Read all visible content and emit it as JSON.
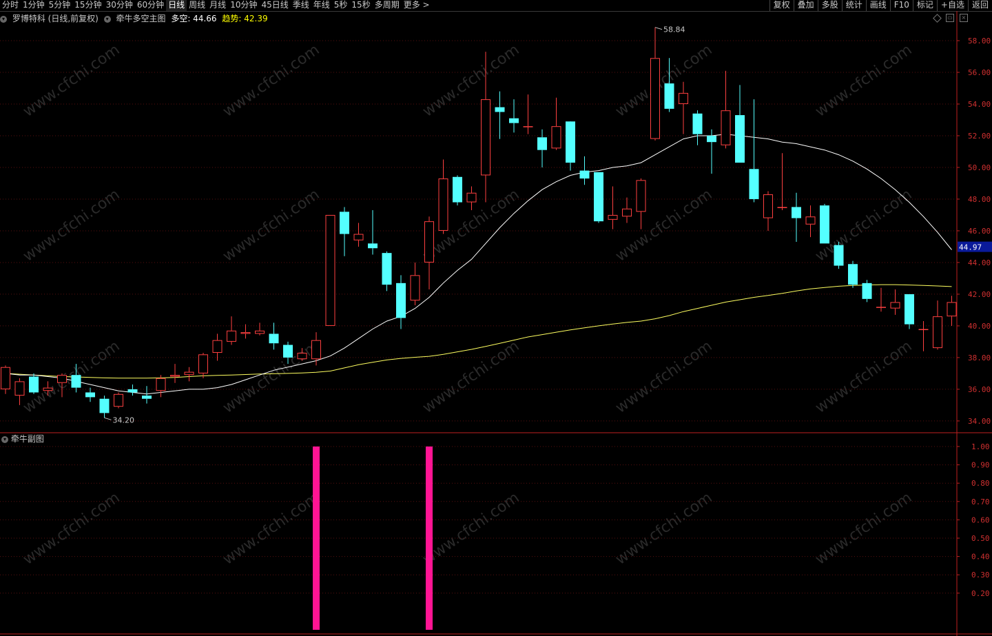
{
  "toolbar": {
    "periods": [
      "分时",
      "1分钟",
      "5分钟",
      "15分钟",
      "30分钟",
      "60分钟",
      "日线",
      "周线",
      "月线",
      "10分钟",
      "45日线",
      "季线",
      "年线",
      "5秒",
      "15秒",
      "多周期",
      "更多 >"
    ],
    "active_period": "日线",
    "right_tools": [
      "复权",
      "叠加",
      "多股",
      "统计",
      "画线",
      "F10",
      "标记",
      "+自选",
      "返回"
    ]
  },
  "main_info": {
    "stock": "罗博特科 (日线,前复权)",
    "indicator": "牵牛多空主图",
    "duokong_label": "多空: 44.66",
    "trend_label": "趋势: 42.39"
  },
  "sub_info": {
    "title": "牵牛副图"
  },
  "watermark": "www.cfchi.com",
  "colors": {
    "up": "#ff4040",
    "down": "#54ffff",
    "ma_white": "#ffffff",
    "ma_yellow": "#ffff60",
    "signal": "#ff1493",
    "axis": "#c02020",
    "price_tag_bg": "#0a1a9a"
  },
  "chart_data": {
    "type": "candlestick",
    "ylim": [
      33.3,
      59.0
    ],
    "y_ticks": [
      34,
      36,
      38,
      40,
      42,
      44,
      46,
      48,
      50,
      52,
      54,
      56,
      58
    ],
    "y_tick_labels": [
      "34.00",
      "36.00",
      "38.00",
      "40.00",
      "42.00",
      "44.00",
      "46.00",
      "48.00",
      "50.00",
      "52.00",
      "54.00",
      "56.00",
      "58.00"
    ],
    "current_price": "44.97",
    "high_annotation": {
      "index": 46,
      "label": "58.84"
    },
    "low_annotation": {
      "index": 7,
      "label": "34.20"
    },
    "candles": [
      {
        "o": 36.0,
        "c": 37.4,
        "h": 37.5,
        "l": 35.7
      },
      {
        "o": 35.6,
        "c": 36.5,
        "h": 36.7,
        "l": 35.0
      },
      {
        "o": 36.8,
        "c": 35.8,
        "h": 37.0,
        "l": 35.7
      },
      {
        "o": 35.9,
        "c": 36.1,
        "h": 36.5,
        "l": 35.6
      },
      {
        "o": 36.4,
        "c": 36.9,
        "h": 37.0,
        "l": 35.5
      },
      {
        "o": 36.9,
        "c": 36.1,
        "h": 37.6,
        "l": 35.8
      },
      {
        "o": 35.8,
        "c": 35.5,
        "h": 36.1,
        "l": 35.2
      },
      {
        "o": 35.4,
        "c": 34.5,
        "h": 35.6,
        "l": 34.2
      },
      {
        "o": 34.9,
        "c": 35.7,
        "h": 35.8,
        "l": 34.8
      },
      {
        "o": 36.0,
        "c": 35.8,
        "h": 36.3,
        "l": 35.6
      },
      {
        "o": 35.6,
        "c": 35.4,
        "h": 36.2,
        "l": 35.1
      },
      {
        "o": 35.9,
        "c": 36.7,
        "h": 36.9,
        "l": 35.5
      },
      {
        "o": 36.8,
        "c": 36.9,
        "h": 37.6,
        "l": 36.4
      },
      {
        "o": 36.9,
        "c": 37.1,
        "h": 37.4,
        "l": 36.5
      },
      {
        "o": 37.0,
        "c": 38.2,
        "h": 38.3,
        "l": 36.7
      },
      {
        "o": 38.3,
        "c": 39.1,
        "h": 39.5,
        "l": 37.8
      },
      {
        "o": 39.0,
        "c": 39.7,
        "h": 40.6,
        "l": 38.8
      },
      {
        "o": 39.5,
        "c": 39.6,
        "h": 40.1,
        "l": 39.2
      },
      {
        "o": 39.5,
        "c": 39.7,
        "h": 40.2,
        "l": 39.4
      },
      {
        "o": 39.5,
        "c": 38.9,
        "h": 40.2,
        "l": 38.5
      },
      {
        "o": 38.8,
        "c": 38.0,
        "h": 39.0,
        "l": 37.6
      },
      {
        "o": 37.9,
        "c": 38.3,
        "h": 38.6,
        "l": 37.8
      },
      {
        "o": 37.9,
        "c": 39.1,
        "h": 39.6,
        "l": 37.5
      },
      {
        "o": 40.0,
        "c": 47.0,
        "h": 47.0,
        "l": 40.0
      },
      {
        "o": 47.2,
        "c": 45.8,
        "h": 47.5,
        "l": 44.4
      },
      {
        "o": 45.4,
        "c": 45.8,
        "h": 46.5,
        "l": 45.0
      },
      {
        "o": 45.2,
        "c": 44.9,
        "h": 47.3,
        "l": 44.5
      },
      {
        "o": 44.6,
        "c": 42.6,
        "h": 44.7,
        "l": 42.2
      },
      {
        "o": 42.7,
        "c": 40.5,
        "h": 43.2,
        "l": 39.8
      },
      {
        "o": 41.6,
        "c": 43.2,
        "h": 44.0,
        "l": 41.3
      },
      {
        "o": 44.0,
        "c": 46.6,
        "h": 46.9,
        "l": 42.3
      },
      {
        "o": 46.0,
        "c": 49.3,
        "h": 50.5,
        "l": 45.8
      },
      {
        "o": 49.4,
        "c": 47.8,
        "h": 49.5,
        "l": 47.6
      },
      {
        "o": 47.8,
        "c": 48.4,
        "h": 48.8,
        "l": 47.3
      },
      {
        "o": 49.5,
        "c": 54.3,
        "h": 57.3,
        "l": 47.8
      },
      {
        "o": 53.8,
        "c": 53.5,
        "h": 54.8,
        "l": 51.8
      },
      {
        "o": 53.1,
        "c": 52.8,
        "h": 54.3,
        "l": 52.2
      },
      {
        "o": 52.6,
        "c": 52.6,
        "h": 54.6,
        "l": 52.1
      },
      {
        "o": 51.9,
        "c": 51.1,
        "h": 52.4,
        "l": 50.0
      },
      {
        "o": 51.2,
        "c": 52.6,
        "h": 54.4,
        "l": 51.1
      },
      {
        "o": 52.9,
        "c": 50.3,
        "h": 52.6,
        "l": 49.8
      },
      {
        "o": 49.8,
        "c": 49.3,
        "h": 50.7,
        "l": 48.9
      },
      {
        "o": 49.7,
        "c": 46.6,
        "h": 49.7,
        "l": 46.5
      },
      {
        "o": 46.7,
        "c": 47.0,
        "h": 48.8,
        "l": 46.1
      },
      {
        "o": 46.9,
        "c": 47.4,
        "h": 48.1,
        "l": 46.5
      },
      {
        "o": 47.2,
        "c": 49.2,
        "h": 49.3,
        "l": 46.1
      },
      {
        "o": 51.8,
        "c": 56.9,
        "h": 58.84,
        "l": 51.7
      },
      {
        "o": 55.3,
        "c": 53.7,
        "h": 56.9,
        "l": 53.5
      },
      {
        "o": 54.0,
        "c": 54.7,
        "h": 55.4,
        "l": 52.1
      },
      {
        "o": 53.4,
        "c": 52.1,
        "h": 53.6,
        "l": 51.4
      },
      {
        "o": 52.0,
        "c": 51.6,
        "h": 52.4,
        "l": 49.6
      },
      {
        "o": 51.4,
        "c": 53.6,
        "h": 56.1,
        "l": 51.2
      },
      {
        "o": 53.3,
        "c": 50.3,
        "h": 55.2,
        "l": 50.3
      },
      {
        "o": 49.9,
        "c": 48.0,
        "h": 54.3,
        "l": 47.8
      },
      {
        "o": 46.8,
        "c": 48.3,
        "h": 48.5,
        "l": 46.0
      },
      {
        "o": 47.5,
        "c": 47.5,
        "h": 50.9,
        "l": 47.3
      },
      {
        "o": 47.5,
        "c": 46.8,
        "h": 48.4,
        "l": 45.3
      },
      {
        "o": 46.4,
        "c": 46.9,
        "h": 47.6,
        "l": 45.6
      },
      {
        "o": 47.6,
        "c": 45.2,
        "h": 47.7,
        "l": 45.2
      },
      {
        "o": 45.1,
        "c": 43.8,
        "h": 45.3,
        "l": 43.6
      },
      {
        "o": 43.9,
        "c": 42.6,
        "h": 44.1,
        "l": 42.4
      },
      {
        "o": 42.7,
        "c": 41.7,
        "h": 42.9,
        "l": 41.5
      },
      {
        "o": 41.2,
        "c": 41.2,
        "h": 42.4,
        "l": 40.9
      },
      {
        "o": 41.1,
        "c": 41.5,
        "h": 42.3,
        "l": 40.7
      },
      {
        "o": 42.0,
        "c": 40.1,
        "h": 42.0,
        "l": 39.8
      },
      {
        "o": 39.8,
        "c": 39.8,
        "h": 40.3,
        "l": 38.4
      },
      {
        "o": 38.6,
        "c": 40.6,
        "h": 41.6,
        "l": 38.5
      },
      {
        "o": 40.6,
        "c": 41.5,
        "h": 41.9,
        "l": 40.0
      }
    ],
    "ma_white": [
      37.0,
      36.9,
      36.9,
      36.8,
      36.7,
      36.5,
      36.3,
      36.1,
      35.9,
      35.8,
      35.7,
      35.8,
      35.9,
      36.0,
      36.0,
      36.1,
      36.3,
      36.6,
      36.9,
      37.2,
      37.4,
      37.6,
      37.8,
      38.1,
      38.6,
      39.2,
      39.8,
      40.3,
      40.6,
      41.1,
      41.8,
      42.7,
      43.5,
      44.2,
      45.2,
      46.2,
      47.1,
      47.9,
      48.6,
      49.1,
      49.5,
      49.7,
      49.8,
      50.0,
      50.1,
      50.3,
      50.8,
      51.3,
      51.8,
      52.0,
      52.0,
      52.1,
      52.0,
      51.9,
      51.8,
      51.6,
      51.5,
      51.3,
      51.1,
      50.8,
      50.4,
      49.9,
      49.3,
      48.6,
      47.8,
      46.9,
      45.9,
      44.8
    ],
    "ma_yellow": [
      37.0,
      36.95,
      36.9,
      36.85,
      36.8,
      36.78,
      36.75,
      36.72,
      36.7,
      36.7,
      36.7,
      36.72,
      36.75,
      36.8,
      36.85,
      36.88,
      36.9,
      36.93,
      36.96,
      36.98,
      37.0,
      37.03,
      37.07,
      37.15,
      37.35,
      37.55,
      37.7,
      37.85,
      37.95,
      38.02,
      38.08,
      38.2,
      38.36,
      38.52,
      38.7,
      38.9,
      39.1,
      39.3,
      39.45,
      39.6,
      39.75,
      39.88,
      40.0,
      40.12,
      40.22,
      40.3,
      40.45,
      40.65,
      40.9,
      41.1,
      41.3,
      41.5,
      41.65,
      41.8,
      41.92,
      42.05,
      42.2,
      42.33,
      42.42,
      42.5,
      42.55,
      42.58,
      42.6,
      42.6,
      42.58,
      42.55,
      42.52,
      42.48
    ],
    "sub_chart": {
      "type": "bar",
      "ylim": [
        0,
        1.05
      ],
      "y_ticks": [
        "1.00",
        "0.90",
        "0.80",
        "0.70",
        "0.60",
        "0.50",
        "0.40",
        "0.30",
        "0.20"
      ],
      "signal_indices": [
        22,
        30
      ],
      "signal_value": 1.0
    }
  }
}
